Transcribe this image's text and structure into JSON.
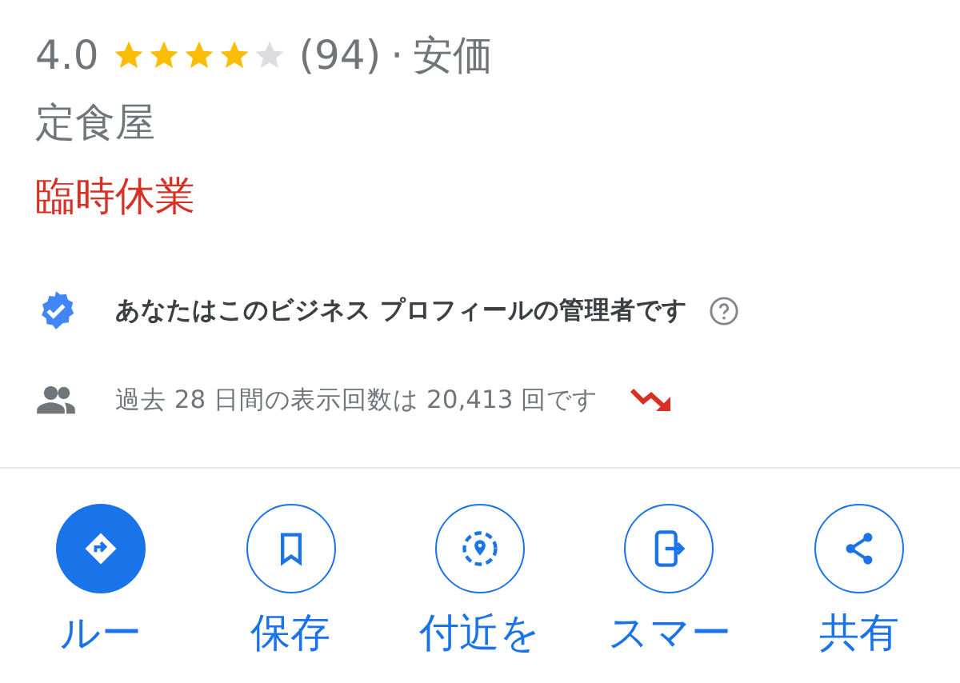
{
  "rating": {
    "score": "4.0",
    "stars": 4,
    "count": "(94)",
    "separator": "·",
    "price": "安価"
  },
  "category": "定食屋",
  "status": "臨時休業",
  "admin_notice": {
    "text": "あなたはこのビジネス プロフィールの管理者です"
  },
  "views": {
    "text": "過去 28 日間の表示回数は 20,413 回です"
  },
  "actions": [
    {
      "label": "ルー",
      "kind": "filled"
    },
    {
      "label": "保存",
      "kind": "outline"
    },
    {
      "label": "付近を",
      "kind": "outline"
    },
    {
      "label": "スマー",
      "kind": "outline"
    },
    {
      "label": "共有",
      "kind": "outline"
    }
  ]
}
